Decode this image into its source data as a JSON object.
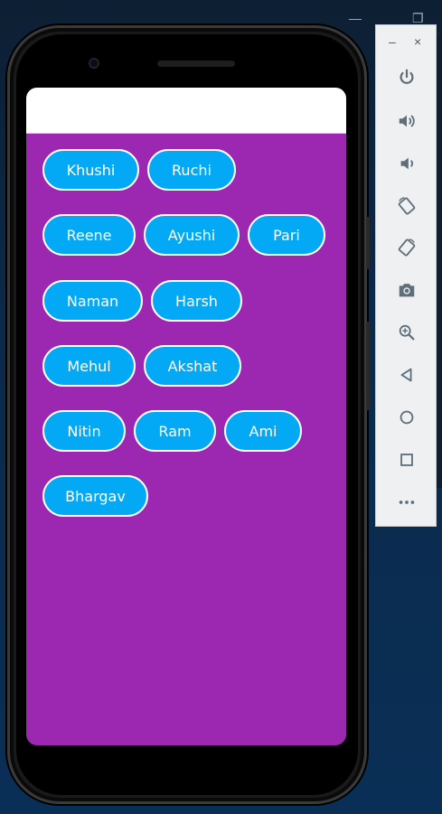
{
  "chips": [
    {
      "label": "Khushi"
    },
    {
      "label": "Ruchi"
    },
    {
      "label": "Reene"
    },
    {
      "label": "Ayushi"
    },
    {
      "label": "Pari"
    },
    {
      "label": "Naman"
    },
    {
      "label": "Harsh"
    },
    {
      "label": "Mehul"
    },
    {
      "label": "Akshat"
    },
    {
      "label": "Nitin"
    },
    {
      "label": "Ram"
    },
    {
      "label": "Ami"
    },
    {
      "label": "Bhargav"
    }
  ],
  "colors": {
    "background": "#9c27b0",
    "chip": "#03a9f4",
    "chip_border": "#ffffff",
    "chip_text": "#ffffff",
    "app_bar": "#ffffff"
  },
  "emulator_toolbar": {
    "minimize": "–",
    "close": "×",
    "tools": [
      "power-icon",
      "volume-up-icon",
      "volume-down-icon",
      "rotate-left-icon",
      "rotate-right-icon",
      "camera-icon",
      "zoom-icon",
      "back-icon",
      "home-icon",
      "overview-icon",
      "more-icon"
    ]
  }
}
